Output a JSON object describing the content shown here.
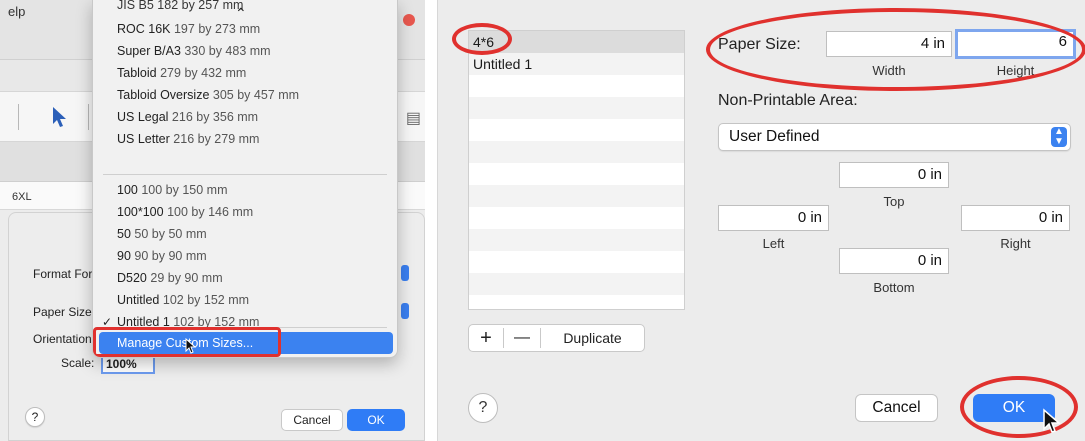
{
  "left_panel": {
    "menu_fragment": "elp",
    "ruler_label": "6XL",
    "dropdown": {
      "cut_item": "JIS B5 182 by 257 mm",
      "group1": [
        {
          "name": "ROC 16K",
          "size": "197 by 273 mm"
        },
        {
          "name": "Super B/A3",
          "size": "330 by 483 mm"
        },
        {
          "name": "Tabloid",
          "size": "279 by 432 mm"
        },
        {
          "name": "Tabloid Oversize",
          "size": "305 by 457 mm"
        },
        {
          "name": "US Legal",
          "size": "216 by 356 mm"
        },
        {
          "name": "US Letter",
          "size": "216 by 279 mm"
        }
      ],
      "group2": [
        {
          "name": "100",
          "size": "100 by 150 mm"
        },
        {
          "name": "100*100",
          "size": "100 by 146 mm"
        },
        {
          "name": "50",
          "size": "50 by 50 mm"
        },
        {
          "name": "90",
          "size": "90 by 90 mm"
        },
        {
          "name": "D520",
          "size": "29 by 90 mm"
        },
        {
          "name": "Untitled",
          "size": "102 by 152 mm"
        },
        {
          "name": "Untitled 1",
          "size": "102 by 152 mm",
          "checked": true
        }
      ],
      "manage_label": "Manage Custom Sizes..."
    },
    "sheet": {
      "format_for_label": "Format For",
      "paper_size_label": "Paper Size",
      "orientation_label": "Orientation",
      "scale_label": "Scale:",
      "scale_value": "100%",
      "help_label": "?",
      "cancel_label": "Cancel",
      "ok_label": "OK"
    }
  },
  "right_panel": {
    "sizes_list": [
      "4*6",
      "Untitled 1"
    ],
    "selected_size": "4*6",
    "add_label": "+",
    "remove_label": "—",
    "duplicate_label": "Duplicate",
    "paper_size_label": "Paper Size:",
    "width_value": "4 in",
    "height_value": "6",
    "width_label": "Width",
    "height_label": "Height",
    "non_printable_label": "Non-Printable Area:",
    "non_printable_value": "User Defined",
    "margins": {
      "top_value": "0 in",
      "top_label": "Top",
      "left_value": "0 in",
      "left_label": "Left",
      "right_value": "0 in",
      "right_label": "Right",
      "bottom_value": "0 in",
      "bottom_label": "Bottom"
    },
    "help_label": "?",
    "cancel_label": "Cancel",
    "ok_label": "OK"
  },
  "colors": {
    "accent_blue": "#2f7cf6",
    "annotation_red": "#e0312e"
  }
}
